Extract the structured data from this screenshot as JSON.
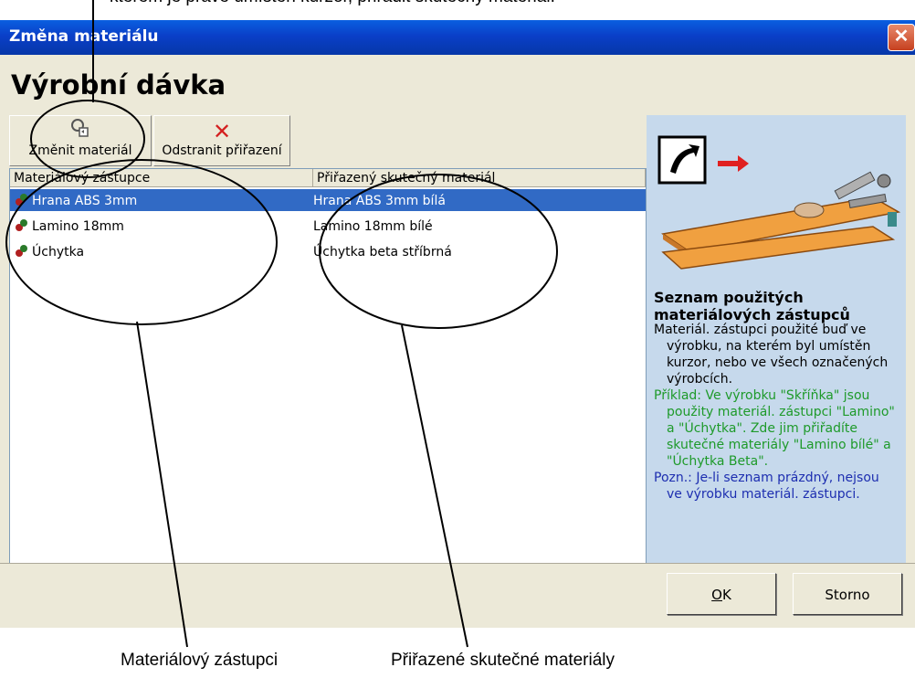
{
  "annotations": {
    "top_text": "kterém je právě umístěn kurzor, přiřadit skutečný materiál.",
    "label_left": "Materiálový zástupci",
    "label_right": "Přiřazené skutečné materiály"
  },
  "window": {
    "title": "Změna materiálu",
    "close_glyph": "✕",
    "page_title": "Výrobní dávka"
  },
  "toolbar": {
    "change_label": "Změnit materiál",
    "change_icon": "change-material-icon",
    "remove_label": "Odstranit přiřazení",
    "remove_icon": "delete-x-icon",
    "remove_glyph": "✕"
  },
  "list": {
    "columns": [
      "Materiálový zástupce",
      "Přiřazený skutečný materiál"
    ],
    "rows": [
      {
        "placeholder": "Hrana ABS 3mm",
        "material": "Hrana ABS 3mm bílá",
        "selected": true
      },
      {
        "placeholder": "Lamino 18mm",
        "material": "Lamino 18mm bílé",
        "selected": false
      },
      {
        "placeholder": "Úchytka",
        "material": "Úchytka beta stříbrná",
        "selected": false
      }
    ]
  },
  "help": {
    "title": "Seznam použitých materiálových zástupců",
    "p1": "Materiál. zástupci použité buď ve výrobku, na kterém byl umístěn kurzor, nebo ve všech označených výrobcích.",
    "p2": "Příklad: Ve výrobku \"Skříňka\" jsou použity materiál. zástupci \"Lamino\" a \"Úchytka\". Zde jim přiřadíte skutečné materiály \"Lamino bílé\" a \"Úchytka Beta\".",
    "p3": "Pozn.: Je-li seznam prázdný, nejsou ve výrobku materiál. zástupci."
  },
  "buttons": {
    "ok_label": "OK",
    "ok_mnemonic": "O",
    "ok_rest": "K",
    "cancel_label": "Storno"
  },
  "colors": {
    "title_bar": "#0a3fc8",
    "selection": "#316ac5",
    "help_bg": "#c6d9ec",
    "help_example": "#1e9a2a",
    "help_note": "#1d2eb0"
  }
}
